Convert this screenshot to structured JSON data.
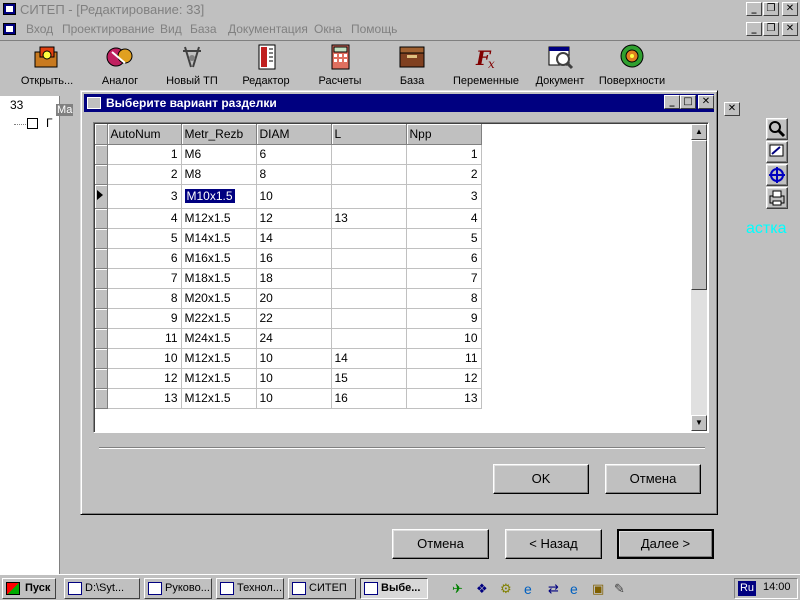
{
  "window": {
    "title": "СИТЕП - [Редактирование: 33]"
  },
  "menu": [
    "Вход",
    "Проектирование",
    "Вид",
    "База",
    "Документация",
    "Окна",
    "Помощь"
  ],
  "toolbar": [
    {
      "label": "Открыть...",
      "icon": "folder-open-icon"
    },
    {
      "label": "Аналог",
      "icon": "analog-icon"
    },
    {
      "label": "Новый ТП",
      "icon": "new-tp-icon"
    },
    {
      "label": "Редактор",
      "icon": "editor-icon"
    },
    {
      "label": "Расчеты",
      "icon": "calculator-icon"
    },
    {
      "label": "База",
      "icon": "database-icon"
    },
    {
      "label": "Переменные",
      "icon": "function-fx-icon"
    },
    {
      "label": "Документ",
      "icon": "document-icon"
    },
    {
      "label": "Поверхности",
      "icon": "surfaces-icon"
    }
  ],
  "background": {
    "tree_label": "33",
    "tree_node": "Г",
    "hidden_title": "Ма",
    "right_label": "астка"
  },
  "dialog": {
    "title": "Выберите вариант разделки",
    "columns": [
      "AutoNum",
      "Metr_Rezb",
      "DIAM",
      "L",
      "Npp"
    ],
    "rows": [
      [
        "1",
        "M6",
        "6",
        "",
        "1"
      ],
      [
        "2",
        "M8",
        "8",
        "",
        "2"
      ],
      [
        "3",
        "M10x1.5",
        "10",
        "",
        "3"
      ],
      [
        "4",
        "M12x1.5",
        "12",
        "13",
        "4"
      ],
      [
        "5",
        "M14x1.5",
        "14",
        "",
        "5"
      ],
      [
        "6",
        "M16x1.5",
        "16",
        "",
        "6"
      ],
      [
        "7",
        "M18x1.5",
        "18",
        "",
        "7"
      ],
      [
        "8",
        "M20x1.5",
        "20",
        "",
        "8"
      ],
      [
        "9",
        "M22x1.5",
        "22",
        "",
        "9"
      ],
      [
        "11",
        "M24x1.5",
        "24",
        "",
        "10"
      ],
      [
        "10",
        "M12x1.5",
        "10",
        "14",
        "11"
      ],
      [
        "12",
        " M12x1.5",
        "10",
        "15",
        "12"
      ],
      [
        "13",
        "M12x1.5",
        "10",
        "16",
        "13"
      ]
    ],
    "current_row": 2,
    "ok_label": "OK",
    "cancel_label": "Отмена"
  },
  "wizard": {
    "cancel_label": "Отмена",
    "back_label": "< Назад",
    "next_label": "Далее >"
  },
  "taskbar": {
    "start_label": "Пуск",
    "tasks": [
      {
        "label": "D:\\Syt...",
        "active": false
      },
      {
        "label": "Руково...",
        "active": false
      },
      {
        "label": "Технол...",
        "active": false
      },
      {
        "label": "СИТЕП",
        "active": false
      },
      {
        "label": "Выбе...",
        "active": true
      }
    ],
    "lang": "Ru",
    "clock": "14:00"
  },
  "colors": {
    "accent": "#000080",
    "face": "#c0c0c0",
    "teal_text": "#00ffff"
  }
}
